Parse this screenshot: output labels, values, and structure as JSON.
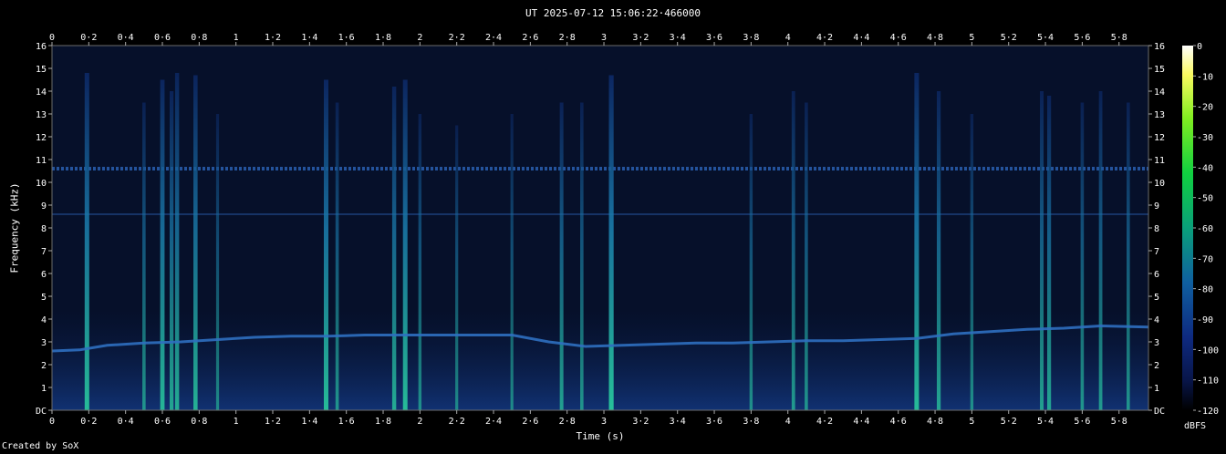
{
  "chart_data": {
    "type": "heatmap",
    "title": "UT 2025-07-12 15:06:22·466000",
    "xlabel": "Time (s)",
    "ylabel": "Frequency (kHz)",
    "xlim": [
      0,
      5.96
    ],
    "ylim": [
      0,
      16
    ],
    "x_ticks": [
      "0",
      "0·2",
      "0·4",
      "0·6",
      "0·8",
      "1",
      "1·2",
      "1·4",
      "1·6",
      "1·8",
      "2",
      "2·2",
      "2·4",
      "2·6",
      "2·8",
      "3",
      "3·2",
      "3·4",
      "3·6",
      "3·8",
      "4",
      "4·2",
      "4·4",
      "4·6",
      "4·8",
      "5",
      "5·2",
      "5·4",
      "5·6",
      "5·8"
    ],
    "y_ticks": [
      "DC",
      "1",
      "2",
      "3",
      "4",
      "5",
      "6",
      "7",
      "8",
      "9",
      "10",
      "11",
      "12",
      "13",
      "14",
      "15",
      "16"
    ],
    "colorbar": {
      "label": "dBFS",
      "ticks": [
        "0",
        "-10",
        "-20",
        "-30",
        "-40",
        "-50",
        "-60",
        "-70",
        "-80",
        "-90",
        "-100",
        "-110",
        "-120"
      ]
    },
    "tone_lines_khz": [
      10.6,
      8.6
    ],
    "pitch_contour": {
      "x": [
        0,
        0.15,
        0.3,
        0.5,
        0.7,
        0.9,
        1.1,
        1.3,
        1.5,
        1.7,
        1.9,
        2.1,
        2.3,
        2.5,
        2.7,
        2.9,
        3.1,
        3.3,
        3.5,
        3.7,
        3.9,
        4.1,
        4.3,
        4.5,
        4.7,
        4.9,
        5.1,
        5.3,
        5.5,
        5.7,
        5.96
      ],
      "y": [
        2.6,
        2.65,
        2.85,
        2.95,
        3.0,
        3.1,
        3.2,
        3.25,
        3.25,
        3.3,
        3.3,
        3.3,
        3.3,
        3.3,
        3.0,
        2.8,
        2.85,
        2.9,
        2.95,
        2.95,
        3.0,
        3.05,
        3.05,
        3.1,
        3.15,
        3.35,
        3.45,
        3.55,
        3.6,
        3.7,
        3.65
      ]
    },
    "transients": [
      {
        "t": 0.19,
        "top": 14.8,
        "level": 0.75
      },
      {
        "t": 0.5,
        "top": 13.5,
        "level": 0.4
      },
      {
        "t": 0.6,
        "top": 14.5,
        "level": 0.7
      },
      {
        "t": 0.65,
        "top": 14.0,
        "level": 0.55
      },
      {
        "t": 0.68,
        "top": 14.8,
        "level": 0.6
      },
      {
        "t": 0.78,
        "top": 14.7,
        "level": 0.65
      },
      {
        "t": 0.9,
        "top": 13.0,
        "level": 0.3
      },
      {
        "t": 1.49,
        "top": 14.5,
        "level": 0.75
      },
      {
        "t": 1.55,
        "top": 13.5,
        "level": 0.4
      },
      {
        "t": 1.86,
        "top": 14.2,
        "level": 0.6
      },
      {
        "t": 1.92,
        "top": 14.5,
        "level": 0.75
      },
      {
        "t": 2.0,
        "top": 13.0,
        "level": 0.35
      },
      {
        "t": 2.2,
        "top": 12.5,
        "level": 0.3
      },
      {
        "t": 2.5,
        "top": 13.0,
        "level": 0.3
      },
      {
        "t": 2.77,
        "top": 13.5,
        "level": 0.5
      },
      {
        "t": 2.88,
        "top": 13.5,
        "level": 0.4
      },
      {
        "t": 3.04,
        "top": 14.7,
        "level": 0.8
      },
      {
        "t": 3.8,
        "top": 13.0,
        "level": 0.35
      },
      {
        "t": 4.03,
        "top": 14.0,
        "level": 0.45
      },
      {
        "t": 4.1,
        "top": 13.5,
        "level": 0.4
      },
      {
        "t": 4.7,
        "top": 14.8,
        "level": 0.75
      },
      {
        "t": 4.82,
        "top": 14.0,
        "level": 0.55
      },
      {
        "t": 5.0,
        "top": 13.0,
        "level": 0.35
      },
      {
        "t": 5.38,
        "top": 14.0,
        "level": 0.5
      },
      {
        "t": 5.42,
        "top": 13.8,
        "level": 0.55
      },
      {
        "t": 5.6,
        "top": 13.5,
        "level": 0.4
      },
      {
        "t": 5.7,
        "top": 14.0,
        "level": 0.45
      },
      {
        "t": 5.85,
        "top": 13.5,
        "level": 0.4
      }
    ]
  },
  "footer": "Created by SoX",
  "colors": {
    "background": "#000000",
    "floor": "#07112b",
    "noise": "#0e2a66",
    "line": "#2a67b8",
    "hot": "#2bd6a0"
  }
}
